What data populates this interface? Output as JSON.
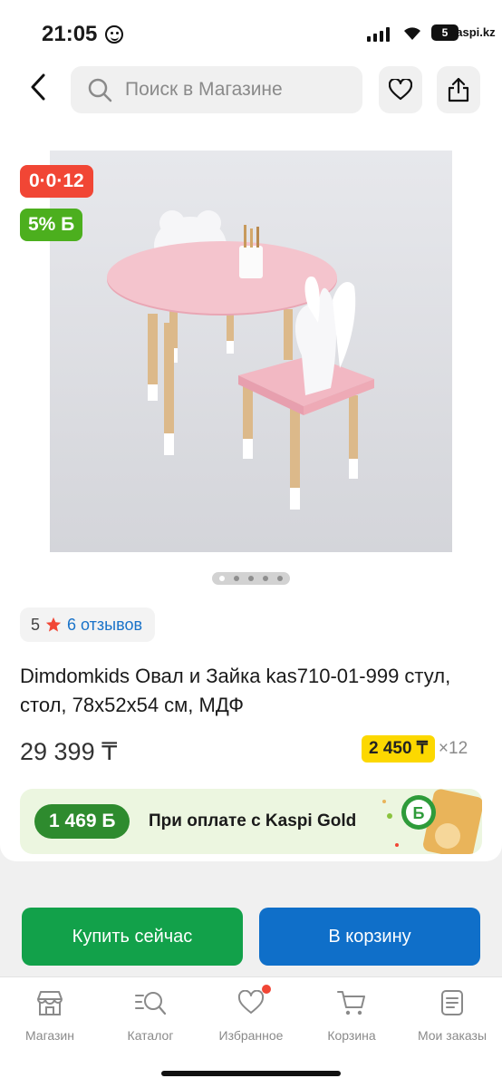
{
  "status_bar": {
    "time": "21:05",
    "carrier": "kaspi.kz",
    "battery": "5"
  },
  "header": {
    "search_placeholder": "Поиск в Магазине"
  },
  "badges": {
    "installment": "0·0·12",
    "bonus": "5% Б"
  },
  "gallery": {
    "count": 5,
    "active": 1
  },
  "rating": {
    "value": "5",
    "reviews": "6 отзывов"
  },
  "product": {
    "title": " Dimdomkids Овал и Зайка kas710-01-999 стул, стол, 78х52х54 см, МДФ",
    "price": "29 399 ₸",
    "installment_amount": "2 450 ₸",
    "installment_multiplier": "×12"
  },
  "kaspi_gold": {
    "bonus": "1 469 Б",
    "text": "При оплате с Kaspi Gold"
  },
  "actions": {
    "buy_now": "Купить сейчас",
    "to_cart": "В корзину"
  },
  "tabbar": {
    "items": [
      {
        "label": "Магазин",
        "icon": "shop-icon"
      },
      {
        "label": "Каталог",
        "icon": "catalog-search-icon"
      },
      {
        "label": "Избранное",
        "icon": "heart-icon"
      },
      {
        "label": "Корзина",
        "icon": "cart-icon"
      },
      {
        "label": "Мои заказы",
        "icon": "orders-icon"
      }
    ]
  },
  "colors": {
    "red_badge": "#f14635",
    "green_badge": "#4caf1e",
    "buy_button": "#12a14a",
    "cart_button": "#0f6fc9",
    "installment_yellow": "#fcd800"
  }
}
